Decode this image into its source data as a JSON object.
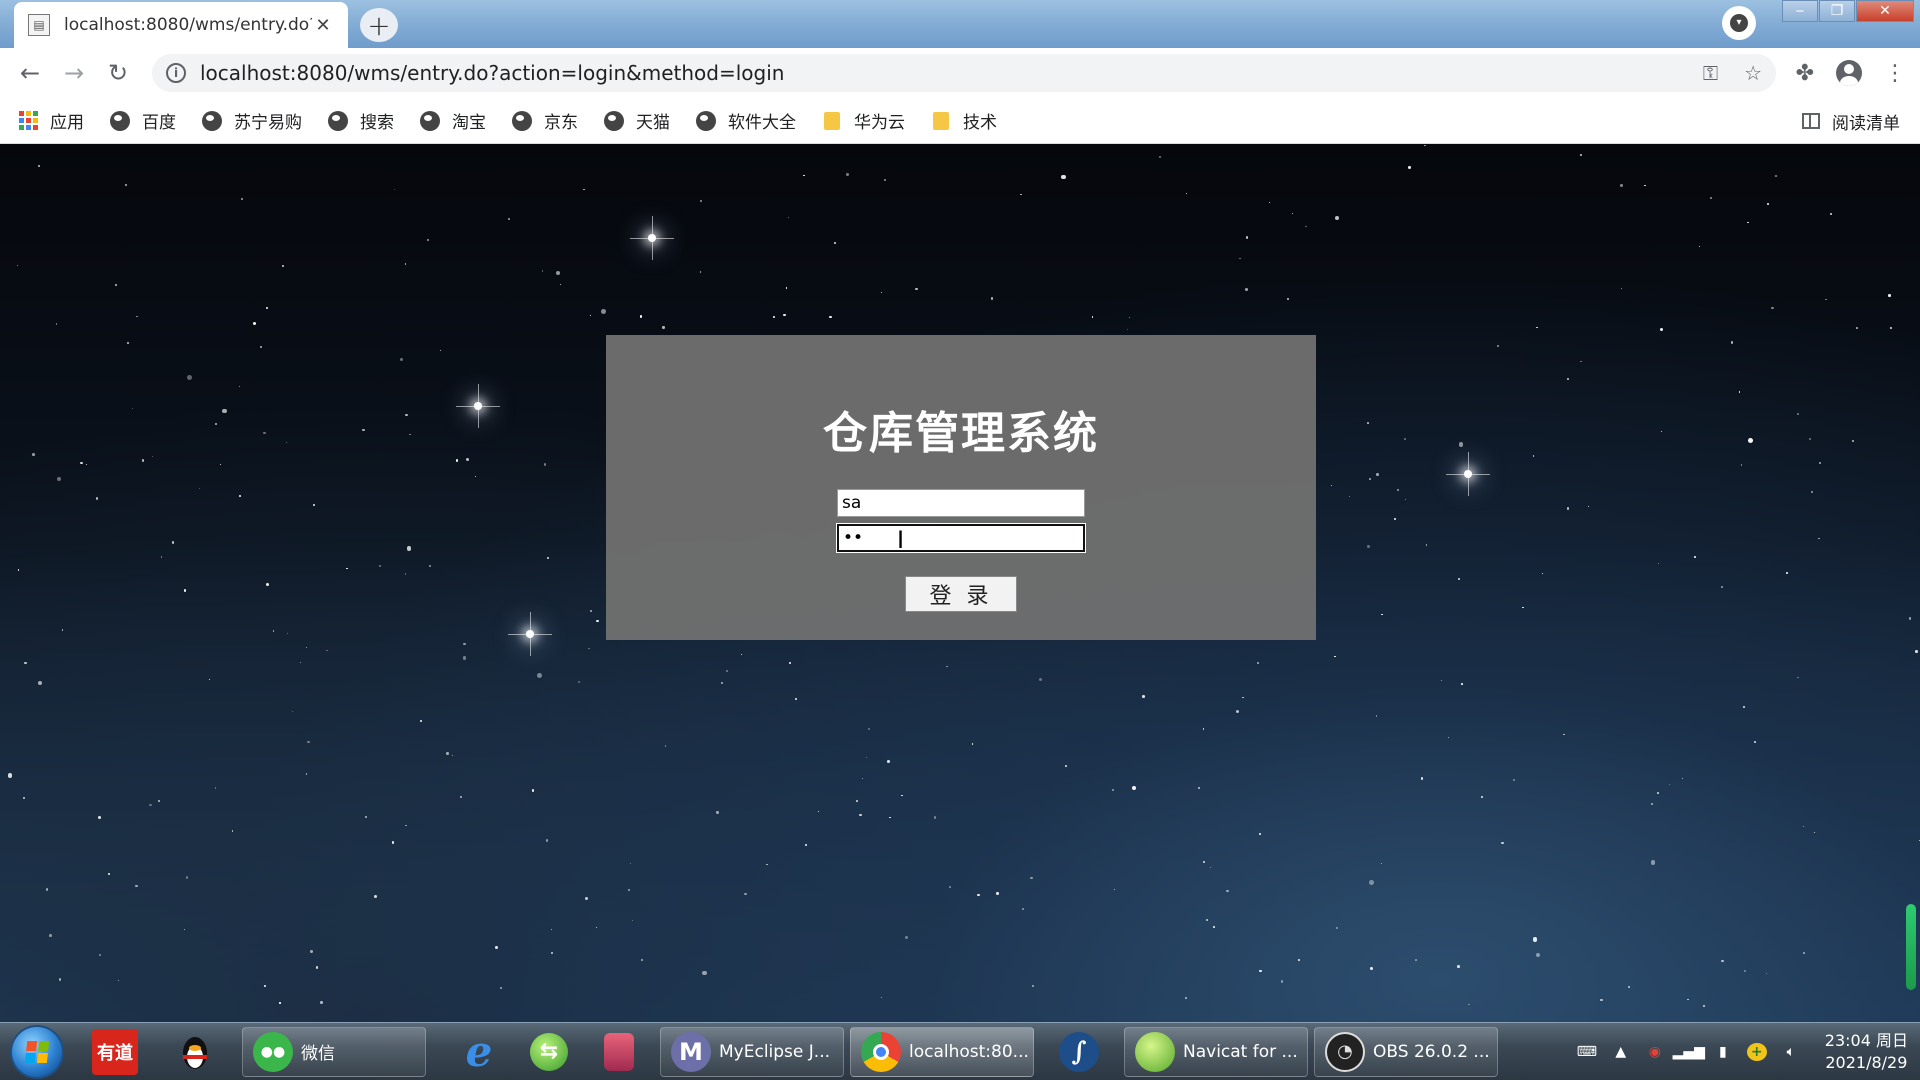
{
  "browser": {
    "tab_title": "localhost:8080/wms/entry.do?",
    "tab_close": "✕",
    "new_tab": "+",
    "url": "localhost:8080/wms/entry.do?action=login&method=login",
    "window_controls": {
      "minimize": "‒",
      "restore": "❐",
      "close": "✕"
    }
  },
  "bookmarks": {
    "items": [
      {
        "label": "应用",
        "icon": "apps-grid-icon"
      },
      {
        "label": "百度",
        "icon": "globe-icon"
      },
      {
        "label": "苏宁易购",
        "icon": "globe-icon"
      },
      {
        "label": "搜索",
        "icon": "globe-icon"
      },
      {
        "label": "淘宝",
        "icon": "globe-icon"
      },
      {
        "label": "京东",
        "icon": "globe-icon"
      },
      {
        "label": "天猫",
        "icon": "globe-icon"
      },
      {
        "label": "软件大全",
        "icon": "globe-icon"
      },
      {
        "label": "华为云",
        "icon": "folder-icon"
      },
      {
        "label": "技术",
        "icon": "folder-icon"
      }
    ],
    "reading_list": "阅读清单"
  },
  "login": {
    "title": "仓库管理系统",
    "username_value": "sa",
    "password_value": "11",
    "submit_label": "登 录"
  },
  "taskbar": {
    "youdao_label": "有道",
    "tasks": [
      {
        "label": "微信"
      },
      {
        "label": "MyEclipse J..."
      },
      {
        "label": "localhost:80..."
      },
      {
        "label": "Navicat for ..."
      },
      {
        "label": "OBS 26.0.2 ..."
      }
    ],
    "clock_time": "23:04 周日",
    "clock_date": "2021/8/29"
  },
  "colors": {
    "login_box_bg": "#6e6e6e",
    "titlebar": "#7fa9d3",
    "folder": "#f6c745",
    "apps_grid": [
      "#ea4335",
      "#fbbc05",
      "#34a853",
      "#4285f4"
    ]
  }
}
